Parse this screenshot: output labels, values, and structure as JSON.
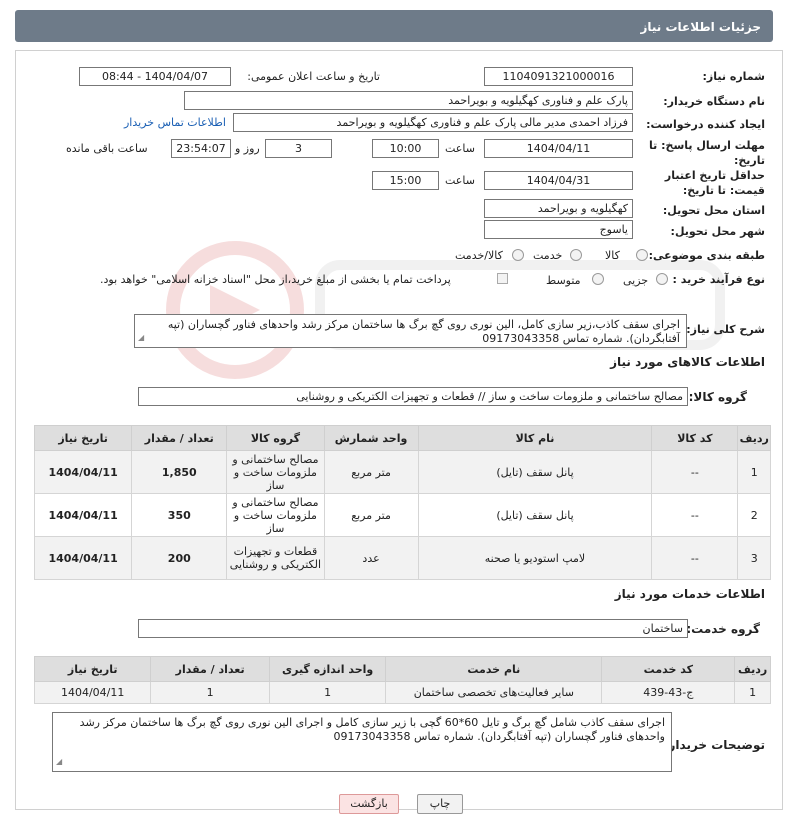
{
  "header": {
    "title": "جزئیات اطلاعات نیاز"
  },
  "form": {
    "need_number_label": "شماره نیاز:",
    "need_number": "1104091321000016",
    "announce_label": "تاریخ و ساعت اعلان عمومی:",
    "announce_value": "1404/04/07 - 08:44",
    "buyer_org_label": "نام دستگاه خریدار:",
    "buyer_org": "پارک علم و فناوری کهگیلویه و بویراحمد",
    "creator_label": "ایجاد کننده درخواست:",
    "creator": "فرزاد احمدی مدیر مالی پارک علم و فناوری کهگیلویه و بویراحمد",
    "contact_link": "اطلاعات تماس خریدار",
    "reply_deadline_label": "مهلت ارسال پاسخ: تا تاریخ:",
    "reply_date": "1404/04/11",
    "time_label": "ساعت",
    "reply_time": "10:00",
    "days_value": "3",
    "days_label": "روز و",
    "remaining_time": "23:54:07",
    "remaining_label": "ساعت باقی مانده",
    "validity_label": "حداقل تاریخ اعتبار قیمت: تا تاریخ:",
    "validity_date": "1404/04/31",
    "validity_time": "15:00",
    "province_label": "استان محل تحویل:",
    "province": "کهگیلویه و بویراحمد",
    "city_label": "شهر محل تحویل:",
    "city": "یاسوج",
    "category_label": "طبقه بندی موضوعی:",
    "category_options": [
      "کالا",
      "خدمت",
      "کالا/خدمت"
    ],
    "process_label": "نوع فرآیند خرید :",
    "process_options": [
      "جزیی",
      "متوسط"
    ],
    "payment_note": "پرداخت تمام یا بخشی از مبلغ خرید،از محل \"اسناد خزانه اسلامی\" خواهد بود.",
    "desc_label": "شرح کلی نیاز:",
    "desc": "اجرای سقف کاذب،زیر سازی کامل، الین نوری روی گچ برگ ها ساختمان مرکز رشد واحدهای فناور گچساران (تپه آفتابگردان). شماره تماس 09173043358"
  },
  "goods": {
    "section_title": "اطلاعات کالاهای مورد نیاز",
    "group_label": "گروه کالا:",
    "group": "مصالح ساختمانی و ملزومات ساخت و ساز // قطعات و تجهیزات الکتریکی و روشنایی",
    "columns": [
      "ردیف",
      "کد کالا",
      "نام کالا",
      "واحد شمارش",
      "گروه کالا",
      "تعداد / مقدار",
      "تاریخ نیاز"
    ],
    "rows": [
      {
        "idx": "1",
        "code": "--",
        "name": "پانل سقف (تایل)",
        "unit": "متر مربع",
        "group": "مصالح ساختمانی و ملزومات ساخت و ساز",
        "qty": "1,850",
        "date": "1404/04/11"
      },
      {
        "idx": "2",
        "code": "--",
        "name": "پانل سقف (تایل)",
        "unit": "متر مربع",
        "group": "مصالح ساختمانی و ملزومات ساخت و ساز",
        "qty": "350",
        "date": "1404/04/11"
      },
      {
        "idx": "3",
        "code": "--",
        "name": "لامپ استودیو یا صحنه",
        "unit": "عدد",
        "group": "قطعات و تجهیزات الکتریکی و روشنایی",
        "qty": "200",
        "date": "1404/04/11"
      }
    ]
  },
  "services": {
    "section_title": "اطلاعات خدمات مورد نیاز",
    "group_label": "گروه خدمت:",
    "group": "ساختمان",
    "columns": [
      "ردیف",
      "کد خدمت",
      "نام خدمت",
      "واحد اندازه گیری",
      "تعداد / مقدار",
      "تاریخ نیاز"
    ],
    "rows": [
      {
        "idx": "1",
        "code": "ج-43-439",
        "name": "سایر فعالیت‌های تخصصی ساختمان",
        "unit": "1",
        "qty": "1",
        "date": "1404/04/11"
      }
    ]
  },
  "buyer_notes": {
    "label": "توضیحات خریدار:",
    "text": "اجرای سقف کاذب شامل گچ برگ و تایل 60*60 گچی با زیر سازی کامل و اجرای الین نوری روی گچ برگ ها ساختمان مرکز رشد واحدهای فناور گچساران (تپه آفتابگردان). شماره تماس 09173043358"
  },
  "buttons": {
    "print": "چاپ",
    "back": "بازگشت"
  }
}
